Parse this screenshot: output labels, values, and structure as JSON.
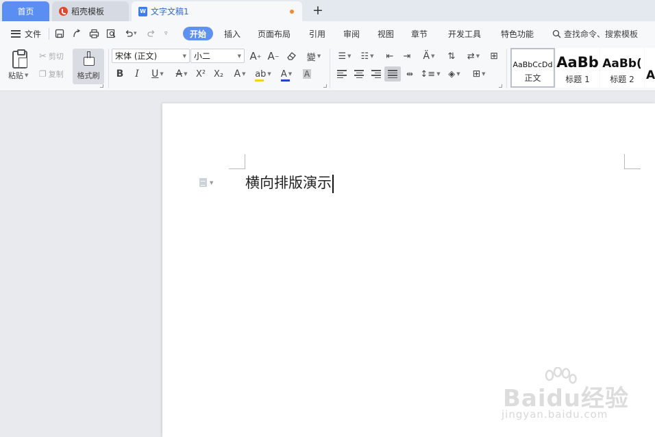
{
  "tabs": {
    "home": "首页",
    "template": "稻壳模板",
    "document": "文字文稿1",
    "document_icon": "W",
    "new_tab": "+"
  },
  "menu": {
    "file": "文件",
    "tabs": [
      "开始",
      "插入",
      "页面布局",
      "引用",
      "审阅",
      "视图",
      "章节",
      "开发工具",
      "特色功能"
    ],
    "active_tab": "开始",
    "search": "查找命令、搜索模板"
  },
  "ribbon": {
    "clipboard": {
      "paste": "粘贴",
      "cut": "剪切",
      "copy": "复制",
      "format_painter": "格式刷"
    },
    "font": {
      "family": "宋体 (正文)",
      "size": "小二"
    },
    "styles": [
      {
        "sample": "AaBbCcDd",
        "name": "正文"
      },
      {
        "sample": "AaBb",
        "name": "标题 1"
      },
      {
        "sample": "AaBb(",
        "name": "标题 2"
      },
      {
        "sample": "A",
        "name": ""
      }
    ]
  },
  "document": {
    "text": "横向排版演示"
  },
  "watermark": {
    "main": "Baidu经验",
    "sub": "jingyan.baidu.com"
  },
  "colors": {
    "accent": "#5f91ef",
    "home_tab": "#5a8ef2",
    "unsaved_dot": "#f08a35",
    "template_logo": "#e5462d",
    "highlight": "#f0d21a",
    "font_color": "#2344c8"
  }
}
